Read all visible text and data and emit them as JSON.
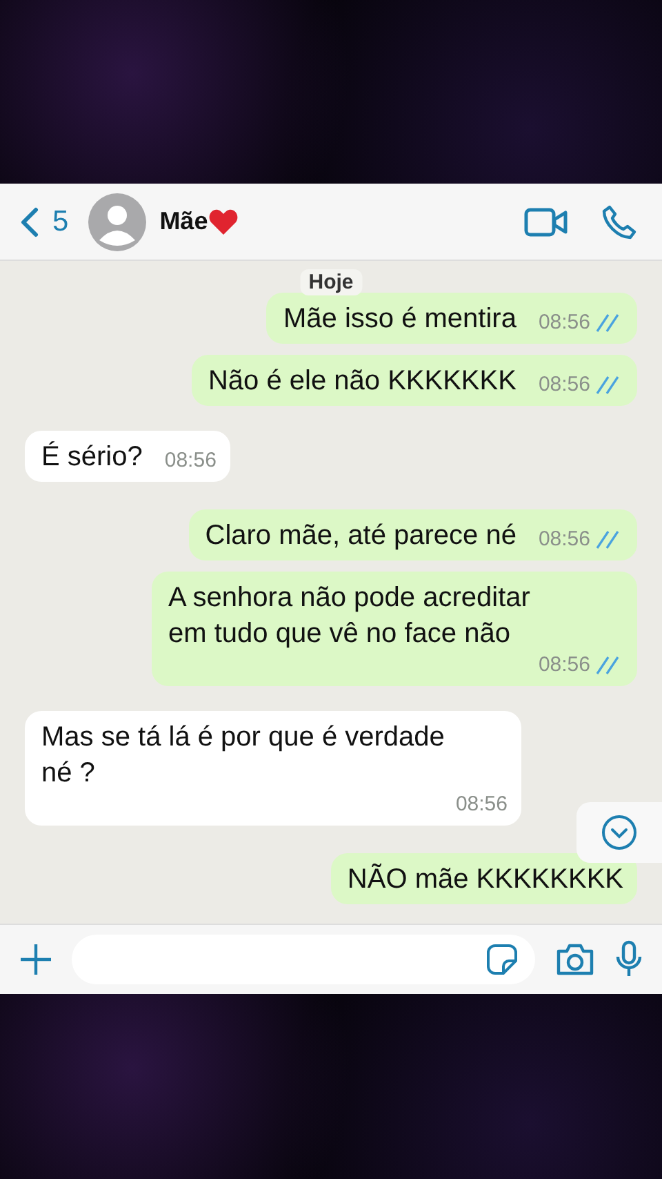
{
  "header": {
    "back_count": "5",
    "contact_name": "Mãe"
  },
  "date_chip": "Hoje",
  "messages": [
    {
      "kind": "sent",
      "text": "Mãe isso é mentira",
      "time": "08:56",
      "read": true
    },
    {
      "kind": "sent",
      "text": "Não é ele não KKKKKKK",
      "time": "08:56",
      "read": true
    },
    {
      "kind": "received",
      "text": "É sério?",
      "time": "08:56"
    },
    {
      "kind": "sent",
      "text": "Claro mãe, até parece né",
      "time": "08:56",
      "read": true
    },
    {
      "kind": "sent",
      "text": "A senhora não pode acreditar em tudo que vê no face não",
      "time": "08:56",
      "read": true
    },
    {
      "kind": "received",
      "text": "Mas se tá lá é por que é verdade né ?",
      "time": "08:56"
    },
    {
      "kind": "sent",
      "text": "NÃO mãe KKKKKKKK"
    }
  ]
}
